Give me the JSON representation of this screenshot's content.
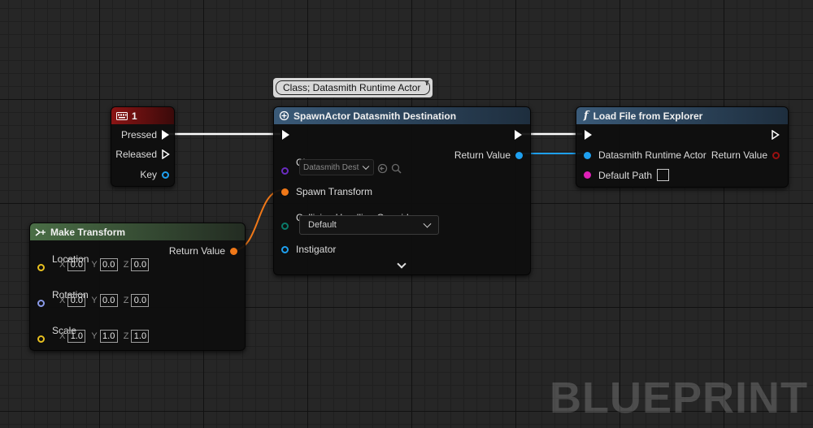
{
  "watermark": "BLUEPRINT",
  "colors": {
    "exec": "#ffffff",
    "object_pin": "#1ea0f0",
    "transform_pin": "#f07818",
    "class_pin": "#6a2cc0",
    "enum_pin": "#0a7a6a",
    "vector_pin": "#e8c020",
    "rotator_pin": "#8a9ae8",
    "string_pin": "#e020b8",
    "event_header": "#7a1010",
    "func_header": "#2c4e6a",
    "pure_header": "#3a5a36"
  },
  "comment_bubble": {
    "text": "Class; Datasmith Runtime Actor"
  },
  "key_node": {
    "title": "1",
    "icon": "keyboard-icon",
    "pins": {
      "pressed": "Pressed",
      "released": "Released",
      "key": "Key"
    }
  },
  "spawn_node": {
    "title": "SpawnActor Datasmith Destination",
    "icon": "spawn-icon",
    "pins": {
      "class": "Class",
      "spawn_transform": "Spawn Transform",
      "collision": "Collision Handling Override",
      "instigator": "Instigator",
      "return_value": "Return Value"
    },
    "class_value": "Datasmith Dest",
    "collision_value": "Default"
  },
  "load_node": {
    "title": "Load File from Explorer",
    "icon": "function-icon",
    "pins": {
      "datasmith_actor": "Datasmith Runtime Actor",
      "default_path": "Default Path",
      "return_value": "Return Value"
    }
  },
  "transform_node": {
    "title": "Make Transform",
    "icon": "pure-function-icon",
    "return_value": "Return Value",
    "location": {
      "label": "Location",
      "x": "0.0",
      "y": "0.0",
      "z": "0.0"
    },
    "rotation": {
      "label": "Rotation",
      "x": "0.0",
      "y": "0.0",
      "z": "0.0"
    },
    "scale": {
      "label": "Scale",
      "x": "1.0",
      "y": "1.0",
      "z": "1.0"
    },
    "axis_labels": {
      "x": "X",
      "y": "Y",
      "z": "Z"
    }
  }
}
